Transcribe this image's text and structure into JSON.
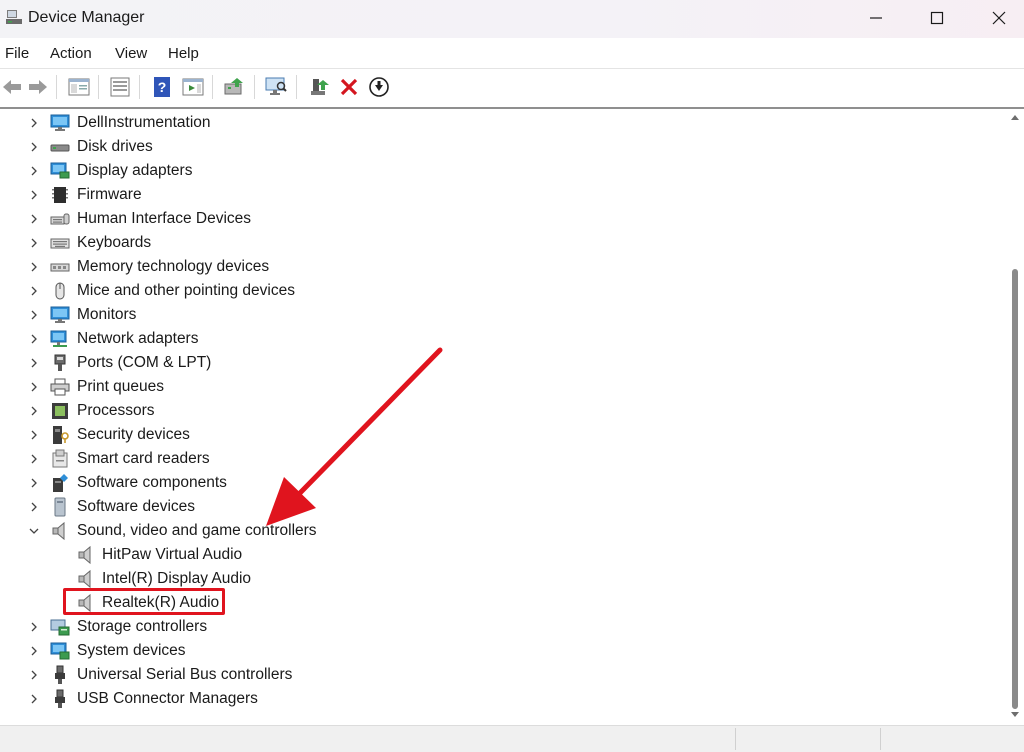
{
  "window": {
    "title": "Device Manager",
    "controls": [
      "minimize",
      "maximize",
      "close"
    ]
  },
  "menu": {
    "items": [
      {
        "label": "File"
      },
      {
        "label": "Action"
      },
      {
        "label": "View"
      },
      {
        "label": "Help"
      }
    ]
  },
  "toolbar": {
    "buttons": [
      {
        "icon": "back-arrow-icon"
      },
      {
        "icon": "forward-arrow-icon"
      },
      {
        "icon": "show-hide-console-tree-icon"
      },
      {
        "icon": "properties-icon"
      },
      {
        "icon": "help-icon"
      },
      {
        "icon": "action-pane-icon"
      },
      {
        "icon": "update-driver-icon"
      },
      {
        "icon": "scan-hardware-icon"
      },
      {
        "icon": "enable-device-icon"
      },
      {
        "icon": "uninstall-device-icon"
      },
      {
        "icon": "disable-device-icon"
      }
    ]
  },
  "tree": {
    "items": [
      {
        "label": "DellInstrumentation",
        "icon": "monitor-icon",
        "expanded": false
      },
      {
        "label": "Disk drives",
        "icon": "disk-drive-icon",
        "expanded": false
      },
      {
        "label": "Display adapters",
        "icon": "display-adapter-icon",
        "expanded": false
      },
      {
        "label": "Firmware",
        "icon": "firmware-chip-icon",
        "expanded": false
      },
      {
        "label": "Human Interface Devices",
        "icon": "hid-icon",
        "expanded": false
      },
      {
        "label": "Keyboards",
        "icon": "keyboard-icon",
        "expanded": false
      },
      {
        "label": "Memory technology devices",
        "icon": "memory-icon",
        "expanded": false
      },
      {
        "label": "Mice and other pointing devices",
        "icon": "mouse-icon",
        "expanded": false
      },
      {
        "label": "Monitors",
        "icon": "monitor-icon",
        "expanded": false
      },
      {
        "label": "Network adapters",
        "icon": "network-adapter-icon",
        "expanded": false
      },
      {
        "label": "Ports (COM & LPT)",
        "icon": "port-icon",
        "expanded": false
      },
      {
        "label": "Print queues",
        "icon": "printer-icon",
        "expanded": false
      },
      {
        "label": "Processors",
        "icon": "processor-icon",
        "expanded": false
      },
      {
        "label": "Security devices",
        "icon": "security-device-icon",
        "expanded": false
      },
      {
        "label": "Smart card readers",
        "icon": "smart-card-reader-icon",
        "expanded": false
      },
      {
        "label": "Software components",
        "icon": "software-component-icon",
        "expanded": false
      },
      {
        "label": "Software devices",
        "icon": "software-device-icon",
        "expanded": false
      },
      {
        "label": "Sound, video and game controllers",
        "icon": "speaker-icon",
        "expanded": true,
        "children": [
          {
            "label": "HitPaw Virtual Audio",
            "icon": "speaker-icon"
          },
          {
            "label": "Intel(R) Display Audio",
            "icon": "speaker-icon"
          },
          {
            "label": "Realtek(R) Audio",
            "icon": "speaker-icon",
            "highlighted": true
          }
        ]
      },
      {
        "label": "Storage controllers",
        "icon": "storage-controller-icon",
        "expanded": false
      },
      {
        "label": "System devices",
        "icon": "system-devices-icon",
        "expanded": false
      },
      {
        "label": "Universal Serial Bus controllers",
        "icon": "usb-icon",
        "expanded": false
      },
      {
        "label": "USB Connector Managers",
        "icon": "usb-icon",
        "expanded": false
      }
    ]
  },
  "annotation": {
    "arrow_color": "#e0141e",
    "highlight_color": "#e0141e",
    "points_to": "Realtek(R) Audio"
  },
  "colors": {
    "accent": "#e0141e",
    "title_bg": "#f3f3f6",
    "status_bg": "#f0f0f0"
  }
}
